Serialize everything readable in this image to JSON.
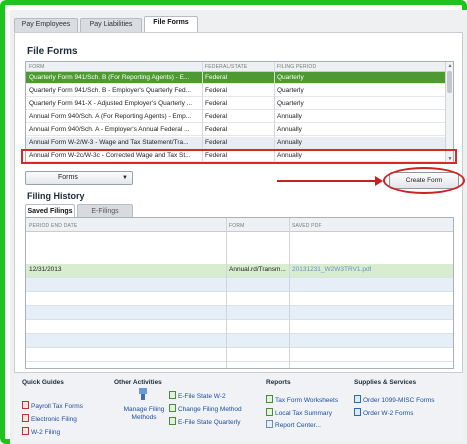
{
  "tabs": [
    "Pay Employees",
    "Pay Liabilities",
    "File Forms"
  ],
  "file_forms": {
    "title": "File Forms",
    "columns": [
      "FORM",
      "FEDERAL/STATE",
      "FILING PERIOD"
    ],
    "rows": [
      [
        "Quarterly Form 941/Sch. B (For Reporting Agents) - E...",
        "Federal",
        "Quarterly"
      ],
      [
        "Quarterly Form 941/Sch. B - Employer's Quarterly Fed...",
        "Federal",
        "Quarterly"
      ],
      [
        "Quarterly Form 941-X - Adjusted Employer's Quarterly ...",
        "Federal",
        "Quarterly"
      ],
      [
        "Annual Form 940/Sch. A (For Reporting Agents) - Emp...",
        "Federal",
        "Annually"
      ],
      [
        "Annual Form 940/Sch. A - Employer's Annual Federal ...",
        "Federal",
        "Annually"
      ],
      [
        "Annual Form W-2/W-3 - Wage and Tax Statement/Tra...",
        "Federal",
        "Annually"
      ],
      [
        "Annual Form W-2c/W-3c - Corrected Wage and Tax St...",
        "Federal",
        "Annually"
      ]
    ],
    "forms_dropdown": "Forms",
    "create_button": "Create Form"
  },
  "filing_history": {
    "title": "Filing History",
    "tabs": [
      "Saved Filings",
      "E-Filings"
    ],
    "columns": [
      "PERIOD END DATE",
      "FORM",
      "SAVED PDF"
    ],
    "rows": [
      [
        "12/31/2013",
        "Annual.rd/Transm...",
        "20131231_W2W3TRV1.pdf"
      ]
    ]
  },
  "bottom": {
    "quick_guides": {
      "title": "Quick Guides",
      "links": [
        "Payroll Tax Forms",
        "Electronic Filing",
        "W-2 Filing"
      ]
    },
    "other_activities": {
      "title": "Other Activities",
      "manage": "Manage Filing Methods",
      "links": [
        "E-File State W-2",
        "Change Filing Method",
        "E-File State Quarterly"
      ]
    },
    "reports": {
      "title": "Reports",
      "links": [
        "Tax Form Worksheets",
        "Local Tax Summary",
        "Report Center..."
      ]
    },
    "supplies": {
      "title": "Supplies & Services",
      "links": [
        "Order 1099-MISC Forms",
        "Order W-2 Forms"
      ]
    }
  },
  "colors": {
    "frame": "#1fc31f",
    "selected_row": "#4e9a32",
    "highlight": "#d42a2a",
    "link": "#1f4fa0"
  }
}
